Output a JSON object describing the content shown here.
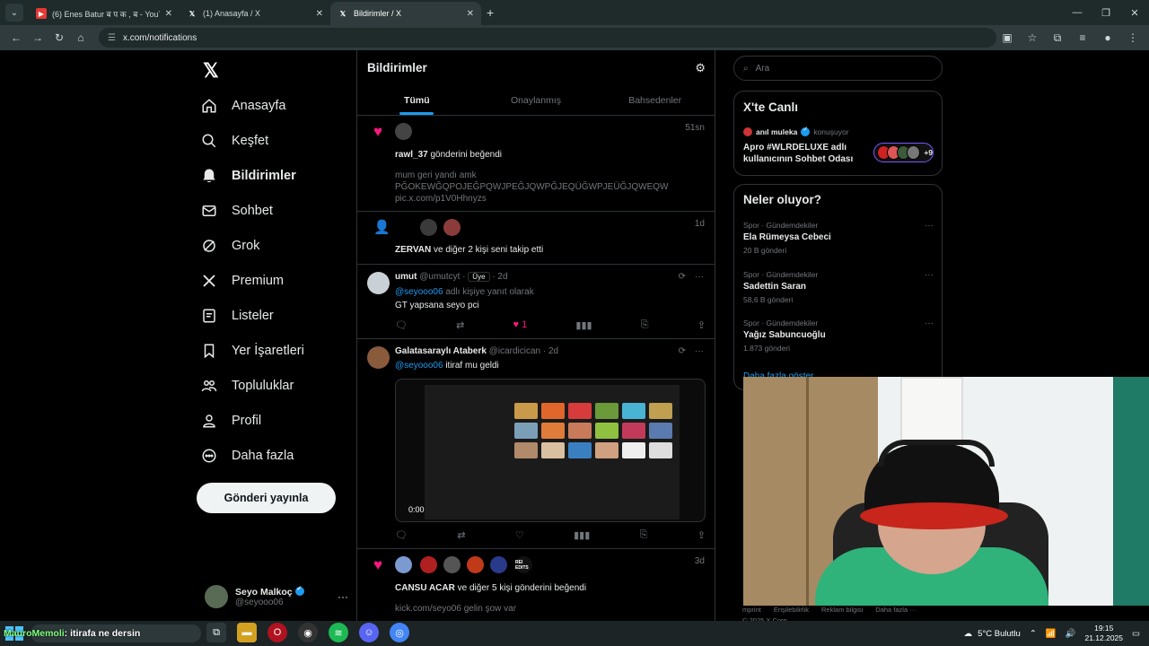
{
  "browser": {
    "tabs": [
      {
        "title": "(6) Enes Batur ब प क , ब - YouTube",
        "favicon": "youtube-icon",
        "active": false
      },
      {
        "title": "(1) Anasayfa / X",
        "favicon": "x-icon",
        "active": false
      },
      {
        "title": "Bildirimler / X",
        "favicon": "x-icon",
        "active": true
      }
    ],
    "url": "x.com/notifications"
  },
  "nav": {
    "items": [
      {
        "label": "Anasayfa",
        "icon": "home-icon"
      },
      {
        "label": "Keşfet",
        "icon": "search-icon"
      },
      {
        "label": "Bildirimler",
        "icon": "bell-icon",
        "active": true
      },
      {
        "label": "Sohbet",
        "icon": "mail-icon"
      },
      {
        "label": "Grok",
        "icon": "grok-icon"
      },
      {
        "label": "Premium",
        "icon": "x-icon"
      },
      {
        "label": "Listeler",
        "icon": "list-icon"
      },
      {
        "label": "Yer İşaretleri",
        "icon": "bookmark-icon"
      },
      {
        "label": "Topluluklar",
        "icon": "people-icon"
      },
      {
        "label": "Profil",
        "icon": "person-icon"
      },
      {
        "label": "Daha fazla",
        "icon": "more-circle-icon"
      }
    ],
    "post_button": "Gönderi yayınla",
    "account": {
      "name": "Seyo Malkoç",
      "handle": "@seyooo06"
    }
  },
  "main": {
    "title": "Bildirimler",
    "tabs": [
      "Tümü",
      "Onaylanmış",
      "Bahsedenler"
    ],
    "notif1": {
      "time": "51sn",
      "user": "rawl_37",
      "action": "gönderini beğendi",
      "preview_lines": [
        "mum geri yandı amk",
        "PĞOKEWĞQPOJEĞPQWJPEĞJQWPĞJEQÜĞWPJEÜĞJQWEQW",
        "pic.x.com/p1V0Hhnyzs"
      ]
    },
    "notif2": {
      "time": "1d",
      "user": "ZERVAN",
      "action": "ve diğer 2 kişi seni takip etti"
    },
    "reply": {
      "name": "umut",
      "handle": "@umutcyt",
      "badge": "Üye",
      "time": "2d",
      "reply_to": "@seyooo06",
      "reply_suffix": "adlı kişiye yanıt olarak",
      "text": "GT yapsana seyo pci",
      "likes": "1"
    },
    "quote": {
      "name": "Galatasaraylı Ataberk",
      "handle": "@icardicican",
      "time": "2d",
      "mention": "@seyooo06",
      "text": "itiraf mu geldi",
      "video_duration": "0:00"
    },
    "notif3": {
      "time": "3d",
      "user": "CANSU ACAR",
      "action": "ve diğer 5 kişi gönderini beğendi",
      "preview": "kick.com/seyo06 gelin şow var",
      "rei_label": "REI EDITS"
    }
  },
  "right": {
    "search_placeholder": "Ara",
    "live": {
      "heading": "X'te Canlı",
      "host": "anıl muleka",
      "host_suffix": "konuşuyor",
      "title": "Apro    #WLRDELUXE adlı kullanıcının Sohbet Odası",
      "extra": "+9"
    },
    "trends": {
      "heading": "Neler oluyor?",
      "items": [
        {
          "category": "Spor · Gündemdekiler",
          "name": "Ela Rümeysa Cebeci",
          "count": "20 B gönderi"
        },
        {
          "category": "Spor · Gündemdekiler",
          "name": "Sadettin Saran",
          "count": "58,6 B gönderi"
        },
        {
          "category": "Spor · Gündemdekiler",
          "name": "Yağız Sabuncuoğlu",
          "count": "1.873 gönderi"
        }
      ],
      "show_more": "Daha fazla göster"
    },
    "footer": [
      "mprint",
      "Erişilebilirlik",
      "Reklam bilgisi",
      "Daha fazla ···"
    ],
    "copyright": "© 2025 X Corp."
  },
  "taskbar": {
    "caption_user": "MauroMemoli",
    "caption_text": ": itirafa ne dersin",
    "weather": "5°C  Bulutlu",
    "time": "19:15",
    "date": "21.12.2025"
  },
  "colors": {
    "accent": "#1d9bf0",
    "like": "#f91880",
    "background": "#000000"
  }
}
